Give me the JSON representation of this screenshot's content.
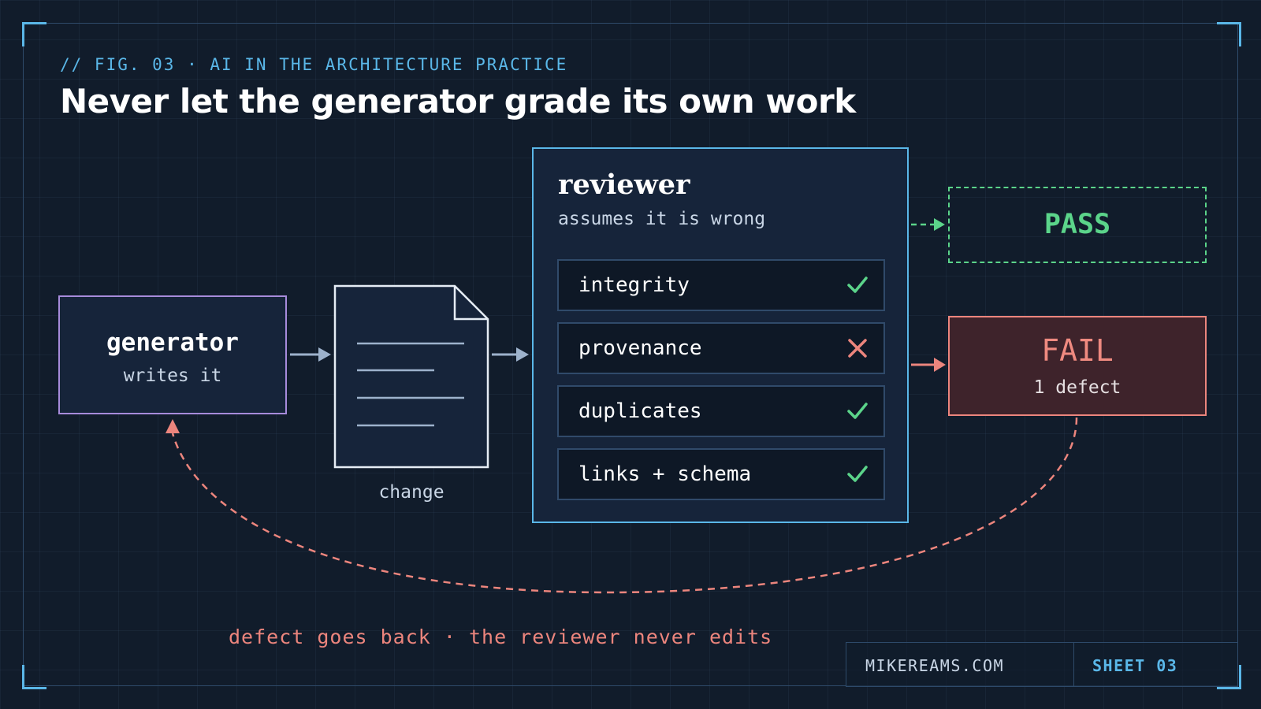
{
  "header": {
    "fig_label": "// FIG. 03 · AI IN THE ARCHITECTURE PRACTICE",
    "title": "Never let the generator grade its own work"
  },
  "generator": {
    "title": "generator",
    "subtitle": "writes it"
  },
  "document": {
    "label": "change"
  },
  "reviewer": {
    "title": "reviewer",
    "subtitle": "assumes it is wrong",
    "checks": [
      {
        "label": "integrity",
        "result": "pass"
      },
      {
        "label": "provenance",
        "result": "fail"
      },
      {
        "label": "duplicates",
        "result": "pass"
      },
      {
        "label": "links + schema",
        "result": "pass"
      }
    ]
  },
  "outcomes": {
    "pass": {
      "label": "PASS"
    },
    "fail": {
      "label": "FAIL",
      "subtitle": "1 defect"
    }
  },
  "footnote": "defect goes back · the reviewer never edits",
  "footer": {
    "site": "MIKEREAMS.COM",
    "sheet": "SHEET 03"
  },
  "colors": {
    "background": "#111c2b",
    "accent_blue": "#5ab7e8",
    "generator_purple": "#a78bdb",
    "pass_green": "#5bd48a",
    "fail_red": "#ec857d"
  },
  "icons": {
    "pass": "check-icon",
    "fail": "cross-icon"
  }
}
